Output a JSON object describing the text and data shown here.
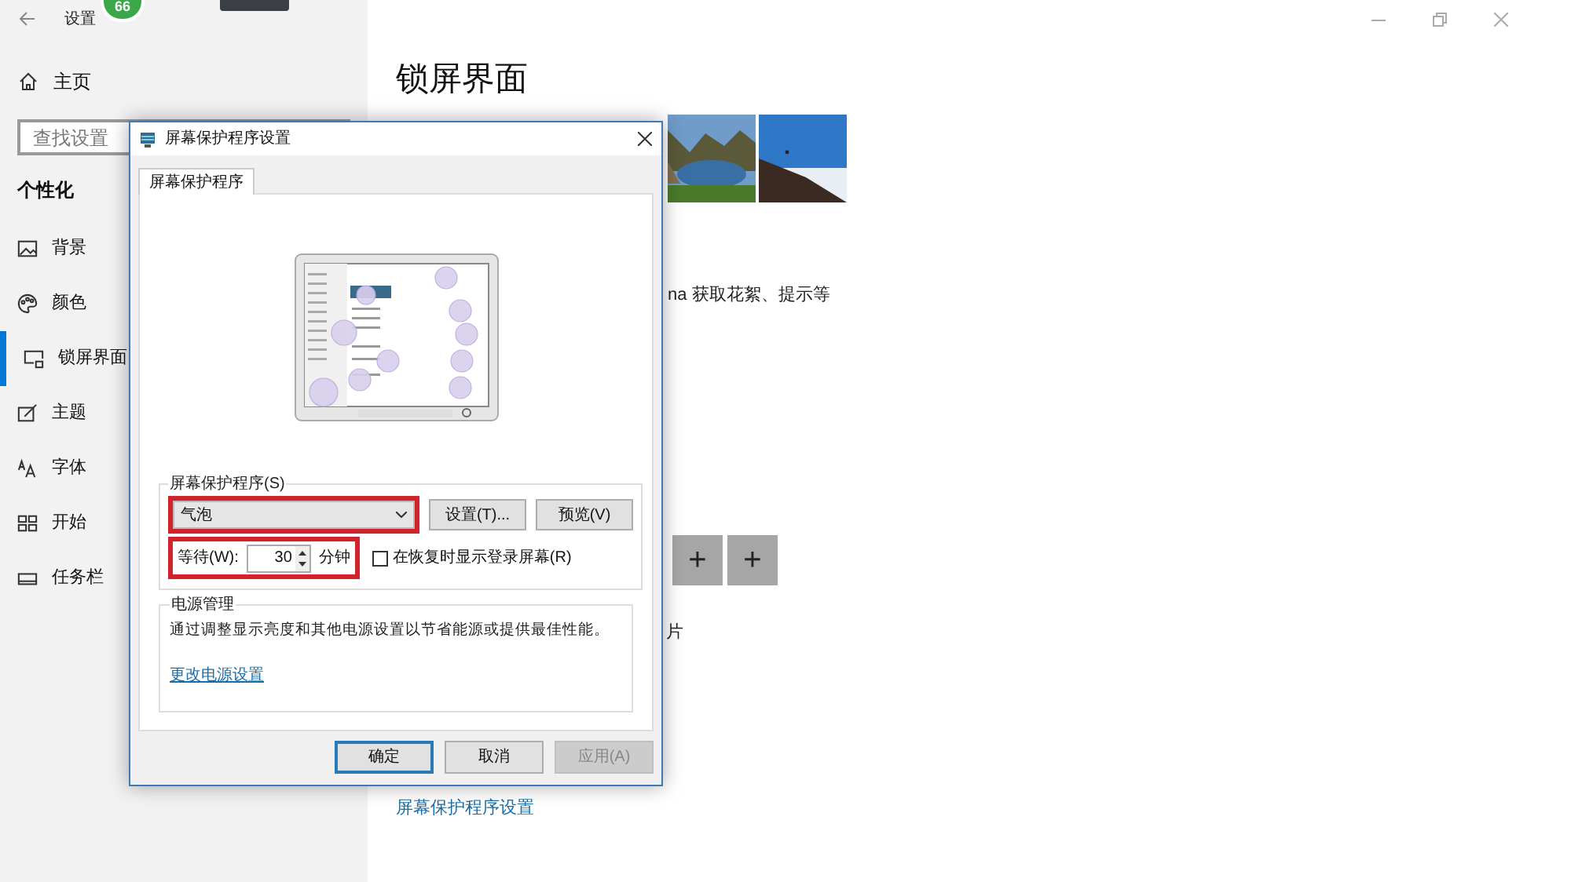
{
  "settings_window": {
    "title": "设置",
    "badge": "66"
  },
  "sidebar": {
    "home": "主页",
    "search": {
      "placeholder": "查找设置"
    },
    "section": "个性化",
    "items": [
      {
        "label": "背景",
        "selected": false
      },
      {
        "label": "颜色",
        "selected": false
      },
      {
        "label": "锁屏界面",
        "selected": true
      },
      {
        "label": "主题",
        "selected": false
      },
      {
        "label": "字体",
        "selected": false
      },
      {
        "label": "开始",
        "selected": false
      },
      {
        "label": "任务栏",
        "selected": false
      }
    ]
  },
  "main": {
    "title": "锁屏界面",
    "description_fragment": "na 获取花絮、提示等",
    "add_buttons": [
      {
        "label": "+"
      },
      {
        "label": "+"
      }
    ],
    "text_fragment": "片",
    "link": "屏幕保护程序设置"
  },
  "dialog": {
    "title": "屏幕保护程序设置",
    "tabs": [
      {
        "label": "屏幕保护程序",
        "selected": true
      }
    ],
    "screensaver": {
      "label": "屏幕保护程序(S)",
      "dropdown": {
        "value": "气泡",
        "highlighted": true
      },
      "buttons": [
        "设置(T)...",
        "预览(V)"
      ],
      "wait": {
        "label": "等待(W):",
        "value": "30",
        "unit": "分钟",
        "highlighted": true
      },
      "checkbox": {
        "label": "在恢复时显示登录屏幕(R)",
        "checked": false
      }
    },
    "power": {
      "label": "电源管理",
      "text": "通过调整显示亮度和其他电源设置以节省能源或提供最佳性能。",
      "link": "更改电源设置"
    },
    "buttons": [
      {
        "label": "确定",
        "default": true,
        "disabled": false
      },
      {
        "label": "取消",
        "default": false,
        "disabled": false
      },
      {
        "label": "应用(A)",
        "default": false,
        "disabled": true
      }
    ]
  }
}
